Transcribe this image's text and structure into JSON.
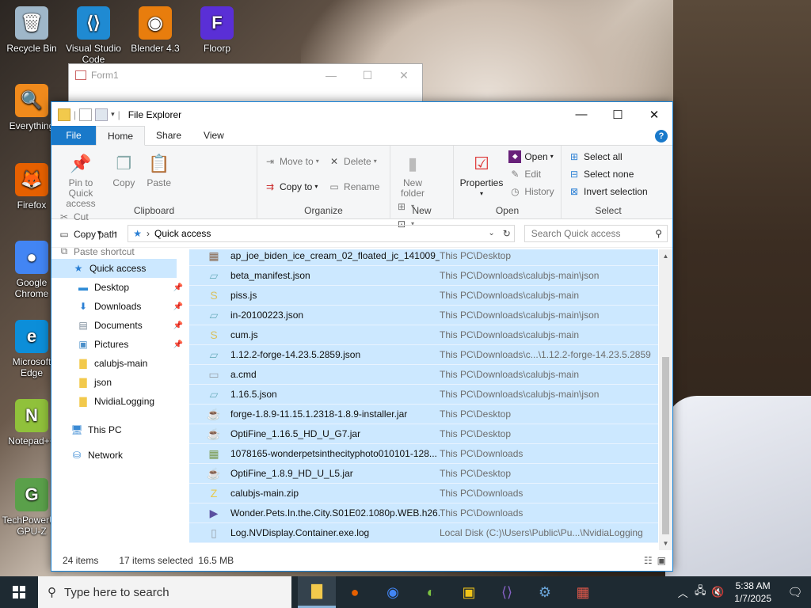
{
  "desktop": {
    "icons": [
      {
        "label": "Recycle Bin",
        "glyph": "🗑",
        "color": "#9fb7c9"
      },
      {
        "label": "Visual Studio Code",
        "glyph": "⟨⟩",
        "color": "#1f8ad2"
      },
      {
        "label": "Blender 4.3",
        "glyph": "◉",
        "color": "#e87d0d"
      },
      {
        "label": "Floorp",
        "glyph": "F",
        "color": "#5a2fd6"
      },
      {
        "label": "Everything",
        "glyph": "🔍",
        "color": "#f08a1c"
      },
      {
        "label": "Firefox",
        "glyph": "🦊",
        "color": "#e66000"
      },
      {
        "label": "Google Chrome",
        "glyph": "●",
        "color": "#4285f4"
      },
      {
        "label": "Microsoft Edge",
        "glyph": "e",
        "color": "#0c8ed9"
      },
      {
        "label": "Notepad++",
        "glyph": "N",
        "color": "#90c13b"
      },
      {
        "label": "TechPowerUp GPU-Z",
        "glyph": "G",
        "color": "#5aa04a"
      }
    ]
  },
  "form1": {
    "title": "Form1",
    "min": "—",
    "max": "☐",
    "close": "✕"
  },
  "explorer": {
    "title": "File Explorer",
    "controls": {
      "min": "—",
      "max": "☐",
      "close": "✕"
    },
    "tabs": {
      "file": "File",
      "home": "Home",
      "share": "Share",
      "view": "View",
      "help": "?"
    },
    "ribbon": {
      "clipboard": {
        "pin": "Pin to Quick access",
        "copy": "Copy",
        "paste": "Paste",
        "cut": "Cut",
        "copy_path": "Copy path",
        "paste_shortcut": "Paste shortcut",
        "label": "Clipboard"
      },
      "organize": {
        "move_to": "Move to",
        "copy_to": "Copy to",
        "delete": "Delete",
        "rename": "Rename",
        "label": "Organize"
      },
      "new": {
        "new_folder": "New folder",
        "label": "New"
      },
      "open": {
        "properties": "Properties",
        "open": "Open",
        "edit": "Edit",
        "history": "History",
        "label": "Open"
      },
      "select": {
        "select_all": "Select all",
        "select_none": "Select none",
        "invert": "Invert selection",
        "label": "Select"
      }
    },
    "address": {
      "path": "Quick access",
      "search_placeholder": "Search Quick access"
    },
    "nav": [
      {
        "label": "Quick access",
        "icon": "star-icon",
        "glyph": "★",
        "color": "#2a7fd4",
        "pinned": false,
        "selected": true
      },
      {
        "label": "Desktop",
        "icon": "desktop-icon",
        "glyph": "▬",
        "color": "#2e8bd6",
        "pinned": true
      },
      {
        "label": "Downloads",
        "icon": "download-icon",
        "glyph": "⬇",
        "color": "#2a7fd4",
        "pinned": true
      },
      {
        "label": "Documents",
        "icon": "document-icon",
        "glyph": "▤",
        "color": "#7a8a99",
        "pinned": true
      },
      {
        "label": "Pictures",
        "icon": "picture-icon",
        "glyph": "▣",
        "color": "#4b8fc9",
        "pinned": true
      },
      {
        "label": "calubjs-main",
        "icon": "folder-icon",
        "glyph": "▇",
        "color": "#f2c94c",
        "pinned": false
      },
      {
        "label": "json",
        "icon": "folder-icon",
        "glyph": "▇",
        "color": "#f2c94c",
        "pinned": false
      },
      {
        "label": "NvidiaLogging",
        "icon": "folder-icon",
        "glyph": "▇",
        "color": "#f2c94c",
        "pinned": false
      }
    ],
    "nav_bottom": [
      {
        "label": "This PC",
        "icon": "computer-icon",
        "glyph": "🖥",
        "color": "#3a8ad4"
      },
      {
        "label": "Network",
        "icon": "network-icon",
        "glyph": "⛁",
        "color": "#3a8ad4"
      }
    ],
    "files": [
      {
        "name": "ap_joe_biden_ice_cream_02_floated_jc_141009_...",
        "location": "This PC\\Desktop",
        "icon": "image-icon",
        "glyph": "▦",
        "color": "#8a6a52"
      },
      {
        "name": "beta_manifest.json",
        "location": "This PC\\Downloads\\calubjs-main\\json",
        "icon": "json-file-icon",
        "glyph": "▱",
        "color": "#6fb0c0"
      },
      {
        "name": "piss.js",
        "location": "This PC\\Downloads\\calubjs-main",
        "icon": "js-file-icon",
        "glyph": "S",
        "color": "#d8c060"
      },
      {
        "name": "in-20100223.json",
        "location": "This PC\\Downloads\\calubjs-main\\json",
        "icon": "json-file-icon",
        "glyph": "▱",
        "color": "#6fb0c0"
      },
      {
        "name": "cum.js",
        "location": "This PC\\Downloads\\calubjs-main",
        "icon": "js-file-icon",
        "glyph": "S",
        "color": "#d8c060"
      },
      {
        "name": "1.12.2-forge-14.23.5.2859.json",
        "location": "This PC\\Downloads\\c...\\1.12.2-forge-14.23.5.2859",
        "icon": "json-file-icon",
        "glyph": "▱",
        "color": "#6fb0c0"
      },
      {
        "name": "a.cmd",
        "location": "This PC\\Downloads\\calubjs-main",
        "icon": "cmd-file-icon",
        "glyph": "▭",
        "color": "#9aa4ad"
      },
      {
        "name": "1.16.5.json",
        "location": "This PC\\Downloads\\calubjs-main\\json",
        "icon": "json-file-icon",
        "glyph": "▱",
        "color": "#6fb0c0"
      },
      {
        "name": "forge-1.8.9-11.15.1.2318-1.8.9-installer.jar",
        "location": "This PC\\Desktop",
        "icon": "jar-file-icon",
        "glyph": "☕",
        "color": "#c0392b"
      },
      {
        "name": "OptiFine_1.16.5_HD_U_G7.jar",
        "location": "This PC\\Desktop",
        "icon": "jar-file-icon",
        "glyph": "☕",
        "color": "#c0392b"
      },
      {
        "name": "1078165-wonderpetsinthecityphoto010101-128...",
        "location": "This PC\\Downloads",
        "icon": "image-icon",
        "glyph": "▦",
        "color": "#7a9a50"
      },
      {
        "name": "OptiFine_1.8.9_HD_U_L5.jar",
        "location": "This PC\\Desktop",
        "icon": "jar-file-icon",
        "glyph": "☕",
        "color": "#c0392b"
      },
      {
        "name": "calubjs-main.zip",
        "location": "This PC\\Downloads",
        "icon": "zip-file-icon",
        "glyph": "Z",
        "color": "#e9c84a"
      },
      {
        "name": "Wonder.Pets.In.the.City.S01E02.1080p.WEB.h26...",
        "location": "This PC\\Downloads",
        "icon": "video-file-icon",
        "glyph": "▶",
        "color": "#5a4fa0"
      },
      {
        "name": "Log.NVDisplay.Container.exe.log",
        "location": "Local Disk (C:)\\Users\\Public\\Pu...\\NvidiaLogging",
        "icon": "log-file-icon",
        "glyph": "▯",
        "color": "#9aa4ad"
      }
    ],
    "status": {
      "items": "24 items",
      "selected": "17 items selected",
      "size": "16.5 MB"
    }
  },
  "taskbar": {
    "search_placeholder": "Type here to search",
    "apps": [
      {
        "name": "file-explorer",
        "glyph": "▇",
        "color": "#f2c94c",
        "active": true
      },
      {
        "name": "firefox",
        "glyph": "●",
        "color": "#e66000"
      },
      {
        "name": "chrome",
        "glyph": "◉",
        "color": "#4285f4"
      },
      {
        "name": "app-green",
        "glyph": "◐",
        "color": "#7cc242"
      },
      {
        "name": "app-yellow",
        "glyph": "▣",
        "color": "#f0c419"
      },
      {
        "name": "visual-studio",
        "glyph": "⟨⟩",
        "color": "#8661c5"
      },
      {
        "name": "app-settings",
        "glyph": "⚙",
        "color": "#6aa4d8"
      },
      {
        "name": "app-tiles",
        "glyph": "▦",
        "color": "#e0584a"
      }
    ],
    "time": "5:38 AM",
    "date": "1/7/2025"
  }
}
